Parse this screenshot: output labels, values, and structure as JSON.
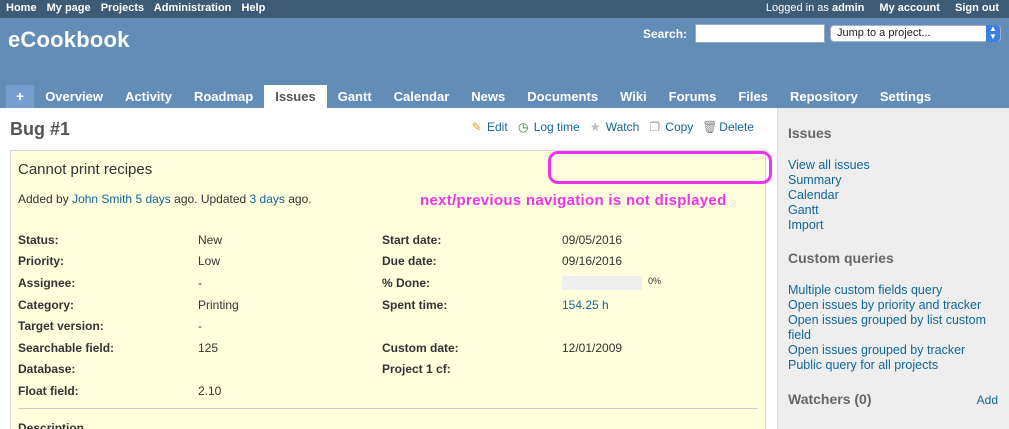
{
  "top_menu": {
    "left": [
      "Home",
      "My page",
      "Projects",
      "Administration",
      "Help"
    ],
    "logged_in_prefix": "Logged in as",
    "user": "admin",
    "my_account": "My account",
    "sign_out": "Sign out"
  },
  "header": {
    "title": "eCookbook",
    "search_label": "Search:",
    "jump": "Jump to a project..."
  },
  "tabs": [
    "+",
    "Overview",
    "Activity",
    "Roadmap",
    "Issues",
    "Gantt",
    "Calendar",
    "News",
    "Documents",
    "Wiki",
    "Forums",
    "Files",
    "Repository",
    "Settings"
  ],
  "issue": {
    "heading": "Bug #1",
    "actions": [
      "Edit",
      "Log time",
      "Watch",
      "Copy",
      "Delete"
    ],
    "subject": "Cannot print recipes",
    "added_by": "Added by",
    "author": "John Smith",
    "created": "5 days",
    "ago_updated": "ago. Updated",
    "updated": "3 days",
    "ago": "ago.",
    "done_percent": 0,
    "done_label": "0%",
    "attributes": [
      {
        "l1": "Status:",
        "v1": "New",
        "l2": "Start date:",
        "v2": "09/05/2016"
      },
      {
        "l1": "Priority:",
        "v1": "Low",
        "l2": "Due date:",
        "v2": "09/16/2016"
      },
      {
        "l1": "Assignee:",
        "v1": "-",
        "l2": "% Done:",
        "v2": ""
      },
      {
        "l1": "Category:",
        "v1": "Printing",
        "l2": "Spent time:",
        "v2": "154.25 h"
      },
      {
        "l1": "Target version:",
        "v1": "-",
        "l2": "",
        "v2": ""
      },
      {
        "l1": "Searchable field:",
        "v1": "125",
        "l2": "Custom date:",
        "v2": "12/01/2009"
      },
      {
        "l1": "Database:",
        "v1": "",
        "l2": "Project 1 cf:",
        "v2": ""
      },
      {
        "l1": "Float field:",
        "v1": "2.10",
        "l2": "",
        "v2": ""
      }
    ],
    "description": "Description"
  },
  "annotation": "next/previous navigation is not displayed",
  "sidebar": {
    "issues_title": "Issues",
    "issues_links": [
      "View all issues",
      "Summary",
      "Calendar",
      "Gantt",
      "Import"
    ],
    "queries_title": "Custom queries",
    "queries_links": [
      "Multiple custom fields query",
      "Open issues by priority and tracker",
      "Open issues grouped by list custom field",
      "Open issues grouped by tracker",
      "Public query for all projects"
    ],
    "watchers_title": "Watchers (0)",
    "add": "Add"
  },
  "colors": {
    "top_bar": "#3E5B76",
    "header": "#628DB6",
    "issue_bg": "#FFFFDD",
    "link": "#116699",
    "annotation": "#EE33EE"
  }
}
